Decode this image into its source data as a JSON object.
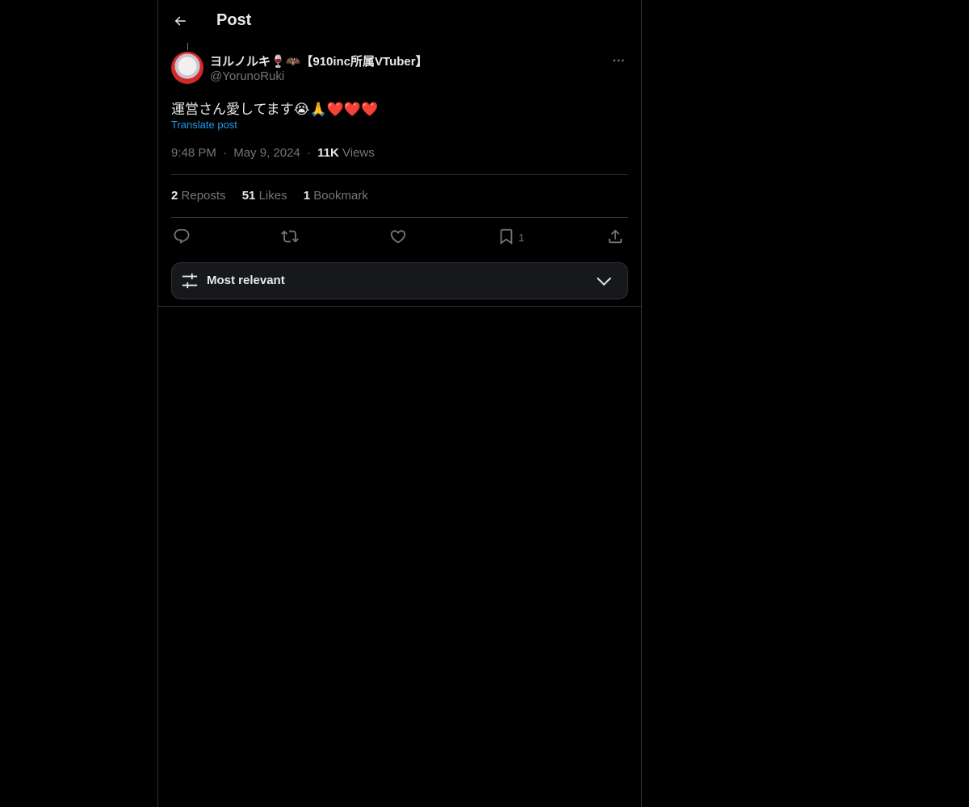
{
  "header": {
    "title": "Post",
    "back_icon": "arrow-left-icon"
  },
  "post": {
    "author": {
      "name": "ヨルノルキ🍷🦇【910inc所属VTuber】",
      "handle": "@YorunoRuki"
    },
    "text": "運営さん愛してます😭🙏❤️❤️❤️",
    "translate_label": "Translate post",
    "time": "9:48 PM",
    "date": "May 9, 2024",
    "views_count": "11K",
    "views_label": "Views",
    "separator": "·"
  },
  "stats": {
    "reposts_count": "2",
    "reposts_label": "Reposts",
    "likes_count": "51",
    "likes_label": "Likes",
    "bookmarks_count": "1",
    "bookmarks_label": "Bookmark"
  },
  "actions": {
    "reply_icon": "reply-icon",
    "repost_icon": "repost-icon",
    "like_icon": "heart-icon",
    "bookmark_icon": "bookmark-icon",
    "bookmark_count": "1",
    "share_icon": "share-icon"
  },
  "sort": {
    "label": "Most relevant"
  },
  "colors": {
    "background": "#000000",
    "text": "#e7e9ea",
    "muted": "#71767b",
    "link": "#1d9bf0",
    "border": "#2f3336"
  }
}
